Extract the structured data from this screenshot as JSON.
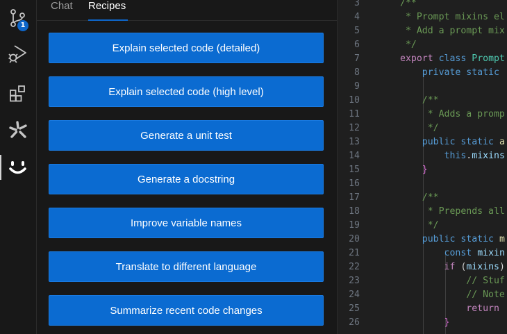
{
  "source_control": {
    "badge": "1"
  },
  "panel": {
    "tabs": [
      {
        "label": "Chat",
        "active": false
      },
      {
        "label": "Recipes",
        "active": true
      }
    ],
    "recipes": [
      "Explain selected code (detailed)",
      "Explain selected code (high level)",
      "Generate a unit test",
      "Generate a docstring",
      "Improve variable names",
      "Translate to different language",
      "Summarize recent code changes"
    ]
  },
  "editor": {
    "line_numbers": [
      "3",
      "4",
      "5",
      "6",
      "7",
      "8",
      "9",
      "10",
      "11",
      "12",
      "13",
      "14",
      "15",
      "16",
      "17",
      "18",
      "19",
      "20",
      "21",
      "22",
      "23",
      "24",
      "25",
      "26"
    ],
    "lines": [
      {
        "segs": [
          {
            "t": "/**",
            "c": "com"
          }
        ]
      },
      {
        "segs": [
          {
            "t": " * Prompt mixins el",
            "c": "com"
          }
        ]
      },
      {
        "segs": [
          {
            "t": " * Add a prompt mix",
            "c": "com"
          }
        ]
      },
      {
        "segs": [
          {
            "t": " */",
            "c": "com"
          }
        ]
      },
      {
        "segs": [
          {
            "t": "export",
            "c": "ctl"
          },
          {
            "t": " "
          },
          {
            "t": "class",
            "c": "kw"
          },
          {
            "t": " "
          },
          {
            "t": "Prompt",
            "c": "cls"
          }
        ]
      },
      {
        "segs": [
          {
            "t": "    "
          },
          {
            "t": "private",
            "c": "kw"
          },
          {
            "t": " "
          },
          {
            "t": "static",
            "c": "kw"
          }
        ]
      },
      {
        "segs": []
      },
      {
        "segs": [
          {
            "t": "    "
          },
          {
            "t": "/**",
            "c": "com"
          }
        ]
      },
      {
        "segs": [
          {
            "t": "    "
          },
          {
            "t": " * Adds a promp",
            "c": "com"
          }
        ]
      },
      {
        "segs": [
          {
            "t": "    "
          },
          {
            "t": " */",
            "c": "com"
          }
        ]
      },
      {
        "segs": [
          {
            "t": "    "
          },
          {
            "t": "public",
            "c": "kw"
          },
          {
            "t": " "
          },
          {
            "t": "static",
            "c": "kw"
          },
          {
            "t": " "
          },
          {
            "t": "a",
            "c": "fn"
          }
        ]
      },
      {
        "segs": [
          {
            "t": "        "
          },
          {
            "t": "this",
            "c": "kw"
          },
          {
            "t": "."
          },
          {
            "t": "mixins",
            "c": "var"
          }
        ]
      },
      {
        "segs": [
          {
            "t": "    "
          },
          {
            "t": "}",
            "c": "br"
          }
        ]
      },
      {
        "segs": []
      },
      {
        "segs": [
          {
            "t": "    "
          },
          {
            "t": "/**",
            "c": "com"
          }
        ]
      },
      {
        "segs": [
          {
            "t": "    "
          },
          {
            "t": " * Prepends all",
            "c": "com"
          }
        ]
      },
      {
        "segs": [
          {
            "t": "    "
          },
          {
            "t": " */",
            "c": "com"
          }
        ]
      },
      {
        "segs": [
          {
            "t": "    "
          },
          {
            "t": "public",
            "c": "kw"
          },
          {
            "t": " "
          },
          {
            "t": "static",
            "c": "kw"
          },
          {
            "t": " "
          },
          {
            "t": "m",
            "c": "fn"
          }
        ]
      },
      {
        "segs": [
          {
            "t": "        "
          },
          {
            "t": "const",
            "c": "kw"
          },
          {
            "t": " "
          },
          {
            "t": "mixin",
            "c": "var"
          }
        ]
      },
      {
        "segs": [
          {
            "t": "        "
          },
          {
            "t": "if",
            "c": "ctl"
          },
          {
            "t": " ("
          },
          {
            "t": "mixins",
            "c": "var"
          },
          {
            "t": ")"
          }
        ]
      },
      {
        "segs": [
          {
            "t": "            "
          },
          {
            "t": "// Stuf",
            "c": "com"
          }
        ]
      },
      {
        "segs": [
          {
            "t": "            "
          },
          {
            "t": "// Note",
            "c": "com"
          }
        ]
      },
      {
        "segs": [
          {
            "t": "            "
          },
          {
            "t": "return",
            "c": "ctl"
          }
        ]
      },
      {
        "segs": [
          {
            "t": "        "
          },
          {
            "t": "}",
            "c": "br"
          }
        ]
      }
    ]
  }
}
